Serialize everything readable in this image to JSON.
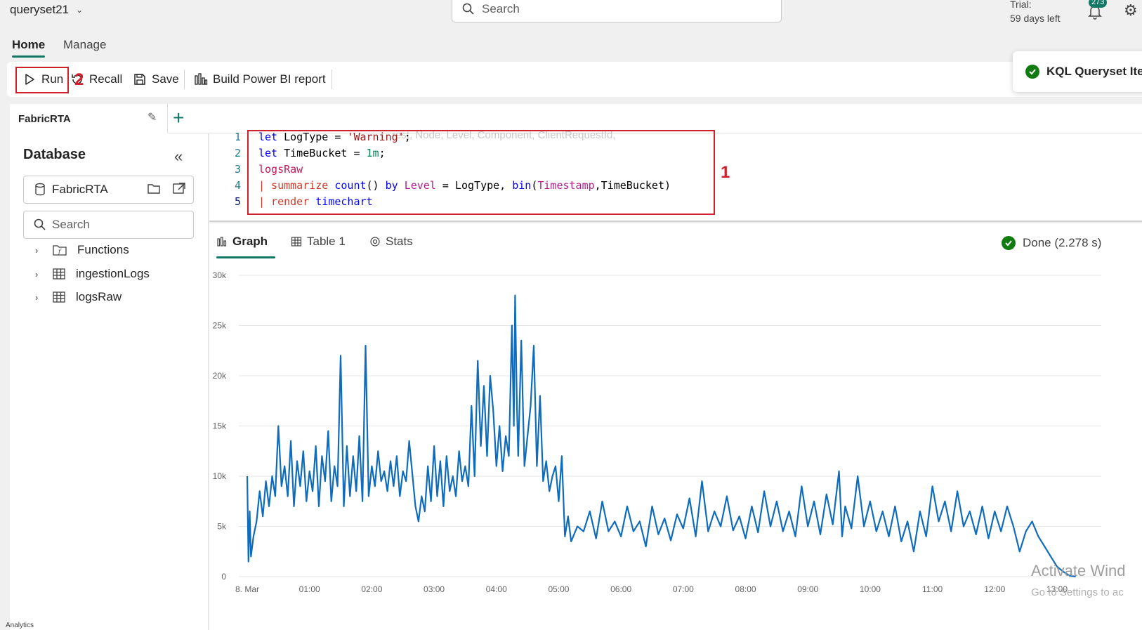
{
  "workspace": {
    "name": "queryset21"
  },
  "global_search": {
    "placeholder": "Search"
  },
  "trial": {
    "line1": "Trial:",
    "line2": "59 days left"
  },
  "notifications": {
    "count": "273"
  },
  "ribbon": {
    "tabs": [
      "Home",
      "Manage"
    ]
  },
  "toolbar": {
    "run": "Run",
    "recall": "Recall",
    "save": "Save",
    "build_report": "Build Power BI report"
  },
  "annotations": {
    "code": "1",
    "run": "2"
  },
  "toast": {
    "text": "KQL Queryset Iter"
  },
  "query_tab": {
    "name": "FabricRTA"
  },
  "sidebar": {
    "title": "Database",
    "database": "FabricRTA",
    "search_placeholder": "Search",
    "items": [
      {
        "label": "Functions",
        "icon": "function-folder-icon"
      },
      {
        "label": "ingestionLogs",
        "icon": "table-icon"
      },
      {
        "label": "logsRaw",
        "icon": "table-icon"
      }
    ]
  },
  "editor": {
    "line_numbers": [
      "1",
      "2",
      "3",
      "4",
      "5"
    ],
    "ghost_text": "rest, Node, Level, Component, ClientRequestId,",
    "lines": [
      "let LogType = 'Warning';",
      "let TimeBucket = 1m;",
      "logsRaw",
      "| summarize count() by Level = LogType, bin(Timestamp,TimeBucket)",
      "| render timechart"
    ]
  },
  "results": {
    "tabs": [
      "Graph",
      "Table 1",
      "Stats"
    ],
    "status": "Done (2.278 s)"
  },
  "watermark": {
    "line1": "Activate Wind",
    "line2": "Go to Settings to ac"
  },
  "footer_text": "Analytics",
  "chart_data": {
    "type": "line",
    "title": "",
    "xlabel": "",
    "ylabel": "",
    "x_ticks": [
      "8. Mar",
      "01:00",
      "02:00",
      "03:00",
      "04:00",
      "05:00",
      "06:00",
      "07:00",
      "08:00",
      "09:00",
      "10:00",
      "11:00",
      "12:00",
      "13:00"
    ],
    "y_ticks": [
      "0",
      "5k",
      "10k",
      "15k",
      "20k",
      "25k",
      "30k"
    ],
    "ylim": [
      0,
      30000
    ],
    "x_range_hours": [
      0,
      13.3
    ],
    "grid": true,
    "color": "#0f6cbd",
    "series": [
      {
        "values": [
          [
            0,
            10000
          ],
          [
            0.02,
            1500
          ],
          [
            0.04,
            6500
          ],
          [
            0.06,
            2000
          ],
          [
            0.1,
            4000
          ],
          [
            0.15,
            5500
          ],
          [
            0.2,
            8500
          ],
          [
            0.25,
            6000
          ],
          [
            0.3,
            9500
          ],
          [
            0.35,
            7000
          ],
          [
            0.4,
            10000
          ],
          [
            0.45,
            8000
          ],
          [
            0.5,
            15000
          ],
          [
            0.55,
            9000
          ],
          [
            0.6,
            11000
          ],
          [
            0.65,
            8000
          ],
          [
            0.7,
            13500
          ],
          [
            0.75,
            7000
          ],
          [
            0.8,
            11500
          ],
          [
            0.85,
            9000
          ],
          [
            0.9,
            12500
          ],
          [
            0.95,
            7500
          ],
          [
            1.0,
            10500
          ],
          [
            1.05,
            8500
          ],
          [
            1.1,
            13000
          ],
          [
            1.15,
            7000
          ],
          [
            1.2,
            12000
          ],
          [
            1.25,
            9500
          ],
          [
            1.3,
            14500
          ],
          [
            1.35,
            7500
          ],
          [
            1.4,
            11000
          ],
          [
            1.45,
            9000
          ],
          [
            1.5,
            22000
          ],
          [
            1.55,
            7000
          ],
          [
            1.6,
            13000
          ],
          [
            1.65,
            8000
          ],
          [
            1.7,
            12000
          ],
          [
            1.75,
            8500
          ],
          [
            1.8,
            14000
          ],
          [
            1.85,
            7500
          ],
          [
            1.9,
            23000
          ],
          [
            1.95,
            8000
          ],
          [
            2.0,
            11000
          ],
          [
            2.05,
            9000
          ],
          [
            2.1,
            12500
          ],
          [
            2.15,
            9500
          ],
          [
            2.2,
            10500
          ],
          [
            2.25,
            8500
          ],
          [
            2.3,
            11500
          ],
          [
            2.35,
            9000
          ],
          [
            2.4,
            12000
          ],
          [
            2.45,
            8000
          ],
          [
            2.5,
            10500
          ],
          [
            2.55,
            9500
          ],
          [
            2.6,
            13500
          ],
          [
            2.7,
            7000
          ],
          [
            2.75,
            5500
          ],
          [
            2.8,
            8000
          ],
          [
            2.85,
            6500
          ],
          [
            2.9,
            11000
          ],
          [
            2.95,
            7500
          ],
          [
            3.0,
            13000
          ],
          [
            3.05,
            8000
          ],
          [
            3.1,
            11500
          ],
          [
            3.15,
            7000
          ],
          [
            3.2,
            12000
          ],
          [
            3.25,
            8500
          ],
          [
            3.3,
            10000
          ],
          [
            3.35,
            8000
          ],
          [
            3.4,
            12500
          ],
          [
            3.45,
            9500
          ],
          [
            3.5,
            11000
          ],
          [
            3.55,
            9000
          ],
          [
            3.6,
            17000
          ],
          [
            3.65,
            10000
          ],
          [
            3.7,
            21500
          ],
          [
            3.75,
            13000
          ],
          [
            3.8,
            19000
          ],
          [
            3.85,
            12000
          ],
          [
            3.9,
            20000
          ],
          [
            3.95,
            16500
          ],
          [
            4.0,
            11000
          ],
          [
            4.05,
            15000
          ],
          [
            4.1,
            10500
          ],
          [
            4.15,
            14000
          ],
          [
            4.2,
            12000
          ],
          [
            4.25,
            25000
          ],
          [
            4.28,
            15000
          ],
          [
            4.3,
            28000
          ],
          [
            4.33,
            17000
          ],
          [
            4.35,
            12000
          ],
          [
            4.4,
            23500
          ],
          [
            4.45,
            11000
          ],
          [
            4.5,
            14000
          ],
          [
            4.55,
            17000
          ],
          [
            4.6,
            23000
          ],
          [
            4.65,
            11000
          ],
          [
            4.7,
            18000
          ],
          [
            4.75,
            9500
          ],
          [
            4.8,
            11500
          ],
          [
            4.85,
            8500
          ],
          [
            4.9,
            10000
          ],
          [
            4.95,
            11000
          ],
          [
            5.0,
            7500
          ],
          [
            5.05,
            12000
          ],
          [
            5.1,
            4000
          ],
          [
            5.15,
            6000
          ],
          [
            5.2,
            3500
          ],
          [
            5.3,
            5000
          ],
          [
            5.4,
            4500
          ],
          [
            5.5,
            6500
          ],
          [
            5.6,
            3800
          ],
          [
            5.7,
            7500
          ],
          [
            5.8,
            4500
          ],
          [
            5.9,
            5500
          ],
          [
            6.0,
            4000
          ],
          [
            6.1,
            7000
          ],
          [
            6.2,
            4500
          ],
          [
            6.3,
            5500
          ],
          [
            6.4,
            3000
          ],
          [
            6.5,
            7000
          ],
          [
            6.6,
            4200
          ],
          [
            6.7,
            5800
          ],
          [
            6.8,
            3600
          ],
          [
            6.9,
            6200
          ],
          [
            7.0,
            4800
          ],
          [
            7.1,
            7800
          ],
          [
            7.2,
            4000
          ],
          [
            7.3,
            9500
          ],
          [
            7.4,
            4500
          ],
          [
            7.5,
            6500
          ],
          [
            7.6,
            5000
          ],
          [
            7.7,
            8000
          ],
          [
            7.8,
            4600
          ],
          [
            7.9,
            6000
          ],
          [
            8.0,
            3800
          ],
          [
            8.1,
            7000
          ],
          [
            8.2,
            4400
          ],
          [
            8.3,
            8500
          ],
          [
            8.4,
            5000
          ],
          [
            8.5,
            7500
          ],
          [
            8.6,
            4500
          ],
          [
            8.7,
            6500
          ],
          [
            8.8,
            4000
          ],
          [
            8.9,
            9000
          ],
          [
            9.0,
            5000
          ],
          [
            9.1,
            7500
          ],
          [
            9.2,
            4200
          ],
          [
            9.3,
            8200
          ],
          [
            9.4,
            5200
          ],
          [
            9.5,
            10500
          ],
          [
            9.55,
            4000
          ],
          [
            9.6,
            7000
          ],
          [
            9.7,
            4800
          ],
          [
            9.8,
            10000
          ],
          [
            9.9,
            5000
          ],
          [
            10.0,
            7500
          ],
          [
            10.1,
            4500
          ],
          [
            10.2,
            6500
          ],
          [
            10.3,
            4000
          ],
          [
            10.4,
            7000
          ],
          [
            10.5,
            3500
          ],
          [
            10.6,
            5500
          ],
          [
            10.7,
            2500
          ],
          [
            10.8,
            6500
          ],
          [
            10.9,
            4000
          ],
          [
            11.0,
            9000
          ],
          [
            11.1,
            5500
          ],
          [
            11.2,
            7500
          ],
          [
            11.3,
            4500
          ],
          [
            11.4,
            8500
          ],
          [
            11.5,
            5000
          ],
          [
            11.6,
            6500
          ],
          [
            11.7,
            4200
          ],
          [
            11.8,
            7000
          ],
          [
            11.9,
            3800
          ],
          [
            12.0,
            6500
          ],
          [
            12.1,
            4500
          ],
          [
            12.2,
            7000
          ],
          [
            12.3,
            5000
          ],
          [
            12.4,
            2500
          ],
          [
            12.5,
            4500
          ],
          [
            12.6,
            5500
          ],
          [
            12.7,
            4000
          ],
          [
            12.8,
            3000
          ],
          [
            12.9,
            2000
          ],
          [
            13.0,
            1000
          ],
          [
            13.1,
            500
          ],
          [
            13.2,
            100
          ],
          [
            13.3,
            0
          ]
        ]
      }
    ]
  }
}
